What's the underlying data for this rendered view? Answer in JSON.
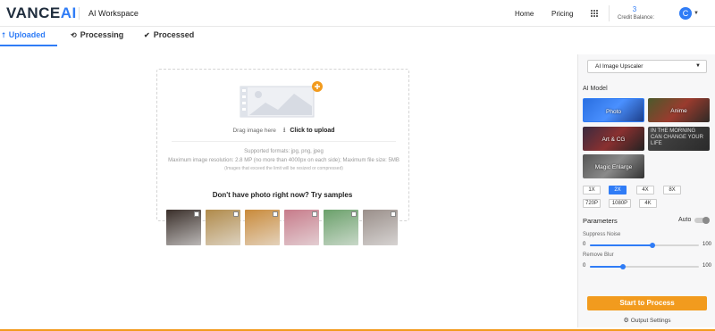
{
  "header": {
    "logo_main": "VANCE",
    "logo_accent": "AI",
    "workspace": "AI Workspace",
    "nav_home": "Home",
    "nav_pricing": "Pricing",
    "credit_count": "3",
    "credit_label": "Credit Balance:",
    "avatar_letter": "C"
  },
  "tabs": {
    "uploaded": "Uploaded",
    "processing": "Processing",
    "processed": "Processed"
  },
  "upload": {
    "drag_text": "Drag image here",
    "click_text": "Click to upload",
    "formats": "Supported formats: jpg, png, jpeg",
    "max_res": "Maximum image resolution: 2.8 MP (no more than 4000px on each side); Maximum file size: 5MB",
    "exceed_note": "(Images that exceed the limit will be resized or compressed)"
  },
  "samples": {
    "title": "Don't have photo right now? Try samples",
    "colors": [
      "#3a2f2a",
      "#b08a4a",
      "#c98a3a",
      "#c77b8a",
      "#6aa06a",
      "#9a8f8a"
    ]
  },
  "panel": {
    "tool_select": "AI Image Upscaler",
    "ai_model_label": "AI Model",
    "models": {
      "photo": "Photo",
      "anime": "Anime",
      "art_cg": "Art & CG",
      "text_line1": "IN THE MORNING",
      "text_line2": "CAN CHANGE YOUR",
      "text_line3": "LIFE",
      "magic": "Magic Enlarge"
    },
    "scales": {
      "s1x": "1X",
      "s2x": "2X",
      "s4x": "4X",
      "s8x": "8X",
      "s720p": "720P",
      "s1080p": "1080P",
      "s4k": "4K"
    },
    "selected_scale": "2X",
    "parameters_label": "Parameters",
    "auto_label": "Auto",
    "suppress_noise_label": "Suppress Noise",
    "suppress_noise_value": 0.57,
    "remove_blur_label": "Remove Blur",
    "remove_blur_value": 0.3,
    "slider_min": "0",
    "slider_max": "100",
    "process_button": "Start to Process",
    "output_settings": "Output Settings"
  },
  "colors": {
    "accent": "#2f7cf6",
    "process": "#f29b1e"
  }
}
